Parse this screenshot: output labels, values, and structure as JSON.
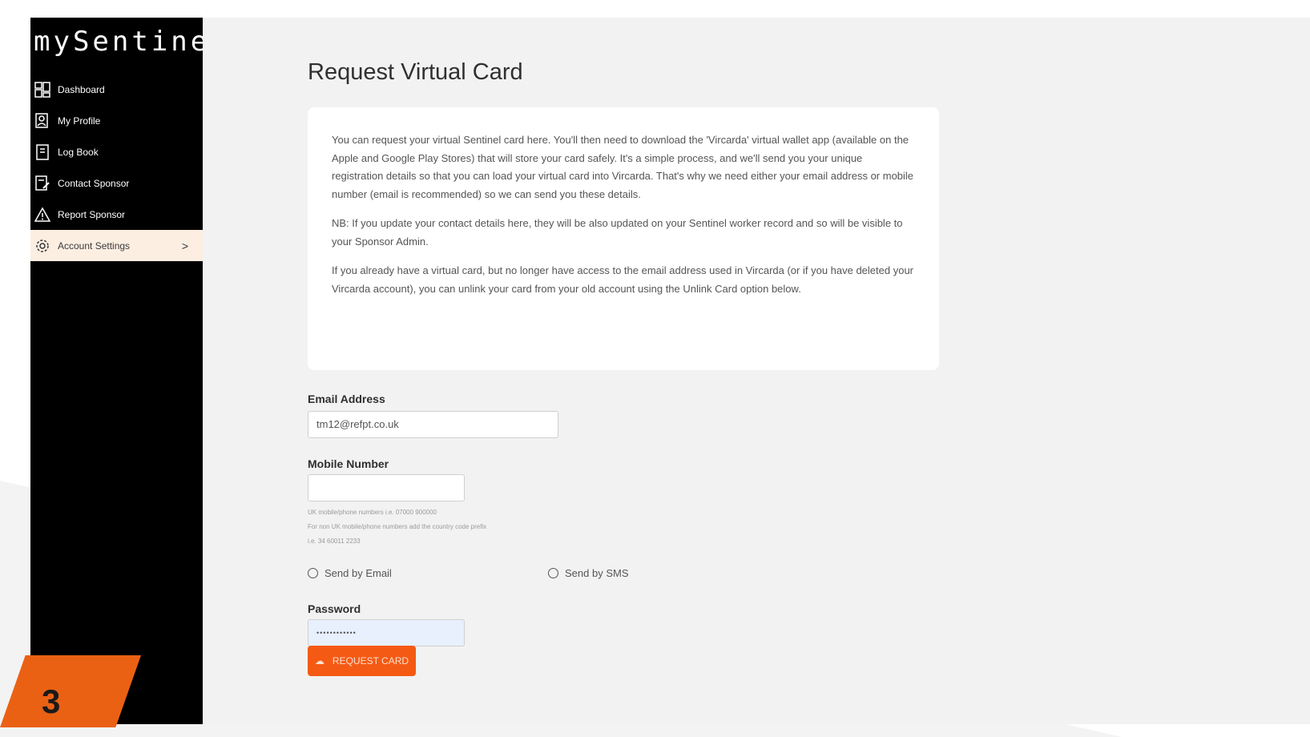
{
  "app": {
    "logo": "mySentinel"
  },
  "sidebar": {
    "items": [
      {
        "label": "Dashboard",
        "icon": "dashboard-icon"
      },
      {
        "label": "My Profile",
        "icon": "profile-icon"
      },
      {
        "label": "Log Book",
        "icon": "logbook-icon"
      },
      {
        "label": "Contact Sponsor",
        "icon": "contact-icon"
      },
      {
        "label": "Report Sponsor",
        "icon": "warning-icon"
      },
      {
        "label": "Account Settings",
        "icon": "gear-icon",
        "active": true,
        "chevron": ">"
      }
    ]
  },
  "main": {
    "title": "Request Virtual Card",
    "info": {
      "p1": "You can request your virtual Sentinel card here. You'll then need to download the 'Vircarda' virtual wallet app (available on the Apple and Google Play Stores) that will store your card safely. It's a simple process, and we'll send you your unique registration details so that you can load your virtual card into Vircarda. That's why we need either your email address or mobile number (email is recommended) so we can send you these details.",
      "p2": "NB: If you update your contact details here, they will be also updated on your Sentinel worker record and so will be visible to your Sponsor Admin.",
      "p3": "If you already have a virtual card, but no longer have access to the email address used in Vircarda (or if you have deleted your Vircarda account), you can unlink your card from your old account using the Unlink Card option below."
    },
    "form": {
      "email_label": "Email Address",
      "email_value": "tm12@refpt.co.uk",
      "mobile_label": "Mobile Number",
      "mobile_value": "",
      "hint1": "UK mobile/phone numbers i.e. 07000 900000",
      "hint2": "For non UK mobile/phone numbers add the country code prefix",
      "hint3": "i.e. 34 60011 2233",
      "radio_email": "Send by Email",
      "radio_sms": "Send by SMS",
      "password_label": "Password",
      "password_value": "••••••••••••",
      "submit_label": "REQUEST CARD"
    }
  },
  "step_badge": "3",
  "colors": {
    "accent": "#f55a14",
    "sidebar": "#000000",
    "active_bg": "#fdeee2",
    "badge": "#ea6114"
  }
}
